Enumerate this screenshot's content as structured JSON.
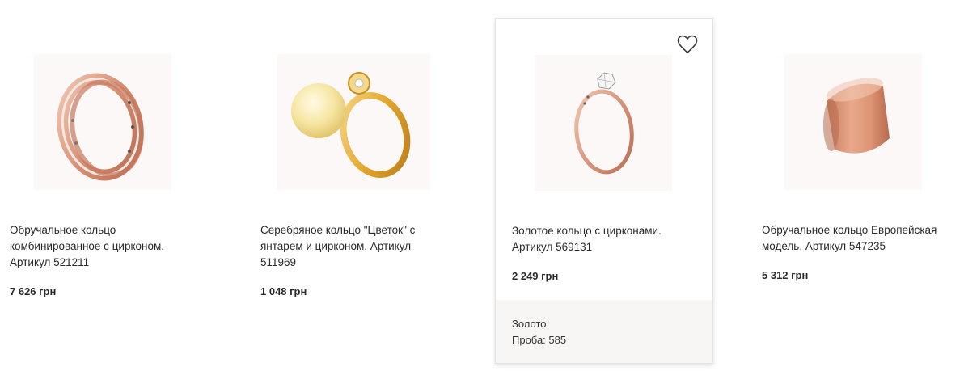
{
  "products": [
    {
      "title": "Обручальное кольцо комбинированное с цирконом. Артикул 521211",
      "price": "7 626 грн",
      "image_icon": "ring-image"
    },
    {
      "title": "Серебряное кольцо \"Цветок\" с янтарем и цирконом. Артикул 511969",
      "price": "1 048 грн",
      "image_icon": "ring-image"
    },
    {
      "title": "Золотое кольцо с цирконами. Артикул 569131",
      "price": "2 249 грн",
      "image_icon": "ring-image",
      "favorite_icon": "heart-outline-icon",
      "properties": {
        "metal": "Золото",
        "probe": "Проба: 585"
      }
    },
    {
      "title": "Обручальное кольцо Европейская модель. Артикул 547235",
      "price": "5 312 грн",
      "image_icon": "ring-image"
    }
  ],
  "colors": {
    "rose_gold": "#d9957a",
    "yellow_gold": "#e8b23a",
    "amber": "#f3e4a6",
    "hover_panel": "#f8f5f5"
  }
}
